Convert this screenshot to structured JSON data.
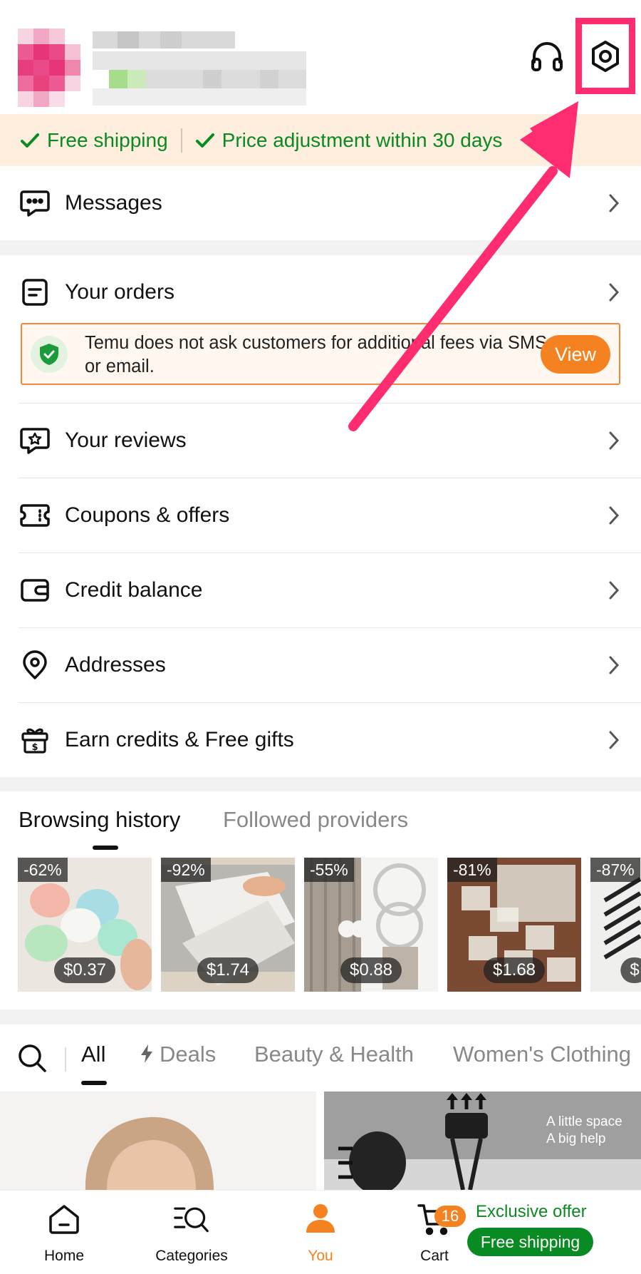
{
  "header": {
    "support_icon": "headset-icon",
    "settings_icon": "settings-hexagon-icon"
  },
  "banner": {
    "item1": "Free shipping",
    "item2": "Price adjustment within 30 days"
  },
  "menu": {
    "messages": "Messages",
    "orders": "Your orders",
    "reviews": "Your reviews",
    "coupons": "Coupons & offers",
    "credit": "Credit balance",
    "addresses": "Addresses",
    "earn": "Earn credits & Free gifts"
  },
  "notice": {
    "text": "Temu does not ask customers for additional fees via SMS or email.",
    "button": "View"
  },
  "history": {
    "tab_active": "Browsing history",
    "tab_inactive": "Followed providers",
    "items": [
      {
        "discount": "-62%",
        "price": "$0.37"
      },
      {
        "discount": "-92%",
        "price": "$1.74"
      },
      {
        "discount": "-55%",
        "price": "$0.88"
      },
      {
        "discount": "-81%",
        "price": "$1.68"
      },
      {
        "discount": "-87%",
        "price": "$"
      }
    ]
  },
  "categories": {
    "all": "All",
    "deals": "Deals",
    "beauty": "Beauty & Health",
    "womens": "Women's Clothing"
  },
  "feed": {
    "promo_line1": "A little space",
    "promo_line2": "A big help"
  },
  "tabbar": {
    "home": "Home",
    "categories": "Categories",
    "you": "You",
    "cart": "Cart",
    "cart_count": "16",
    "offer_text": "Exclusive offer",
    "offer_pill": "Free shipping"
  },
  "colors": {
    "accent": "#f58220",
    "green": "#0a8a22",
    "highlight": "#ff2d6f"
  }
}
